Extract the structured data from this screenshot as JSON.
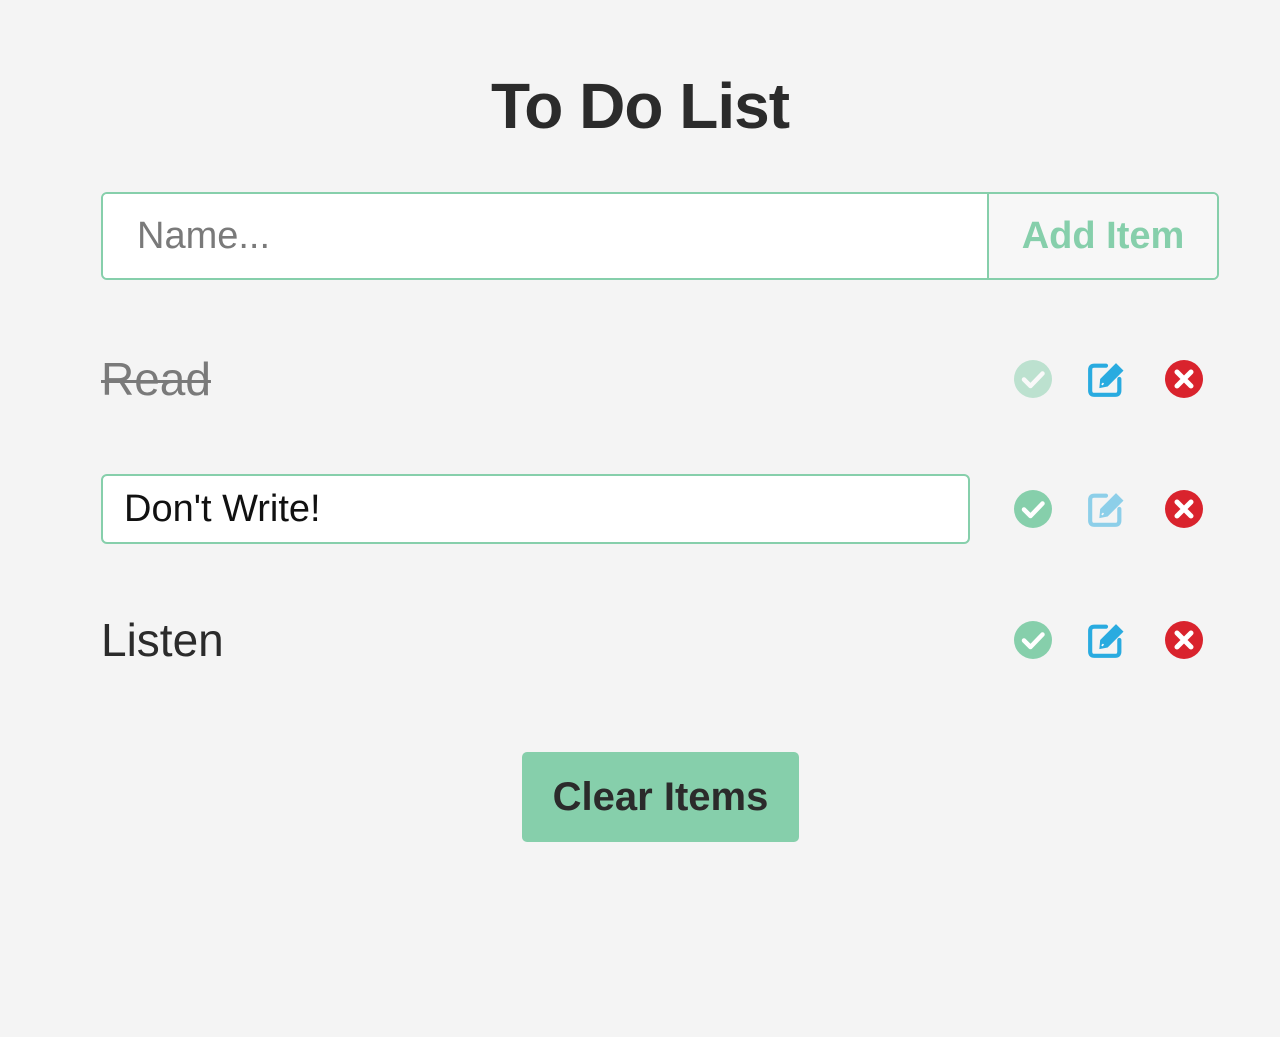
{
  "header": {
    "title": "To Do List"
  },
  "add_form": {
    "input_value": "",
    "input_placeholder": "Name...",
    "add_button_label": "Add Item"
  },
  "items": [
    {
      "text": "Read",
      "completed": true,
      "editing": false,
      "icons": [
        "check-circle-icon",
        "edit-icon",
        "close-circle-icon"
      ]
    },
    {
      "text": "Don't Write!",
      "completed": false,
      "editing": true,
      "icons": [
        "check-circle-icon",
        "edit-icon",
        "close-circle-icon"
      ]
    },
    {
      "text": "Listen",
      "completed": false,
      "editing": false,
      "icons": [
        "check-circle-icon",
        "edit-icon",
        "close-circle-icon"
      ]
    }
  ],
  "footer": {
    "clear_button_label": "Clear Items"
  },
  "colors": {
    "accent": "#86cfab",
    "edit_icon": "#29abe0",
    "delete_icon": "#d9232d",
    "background": "#f4f4f4",
    "text": "#2b2b2b"
  }
}
